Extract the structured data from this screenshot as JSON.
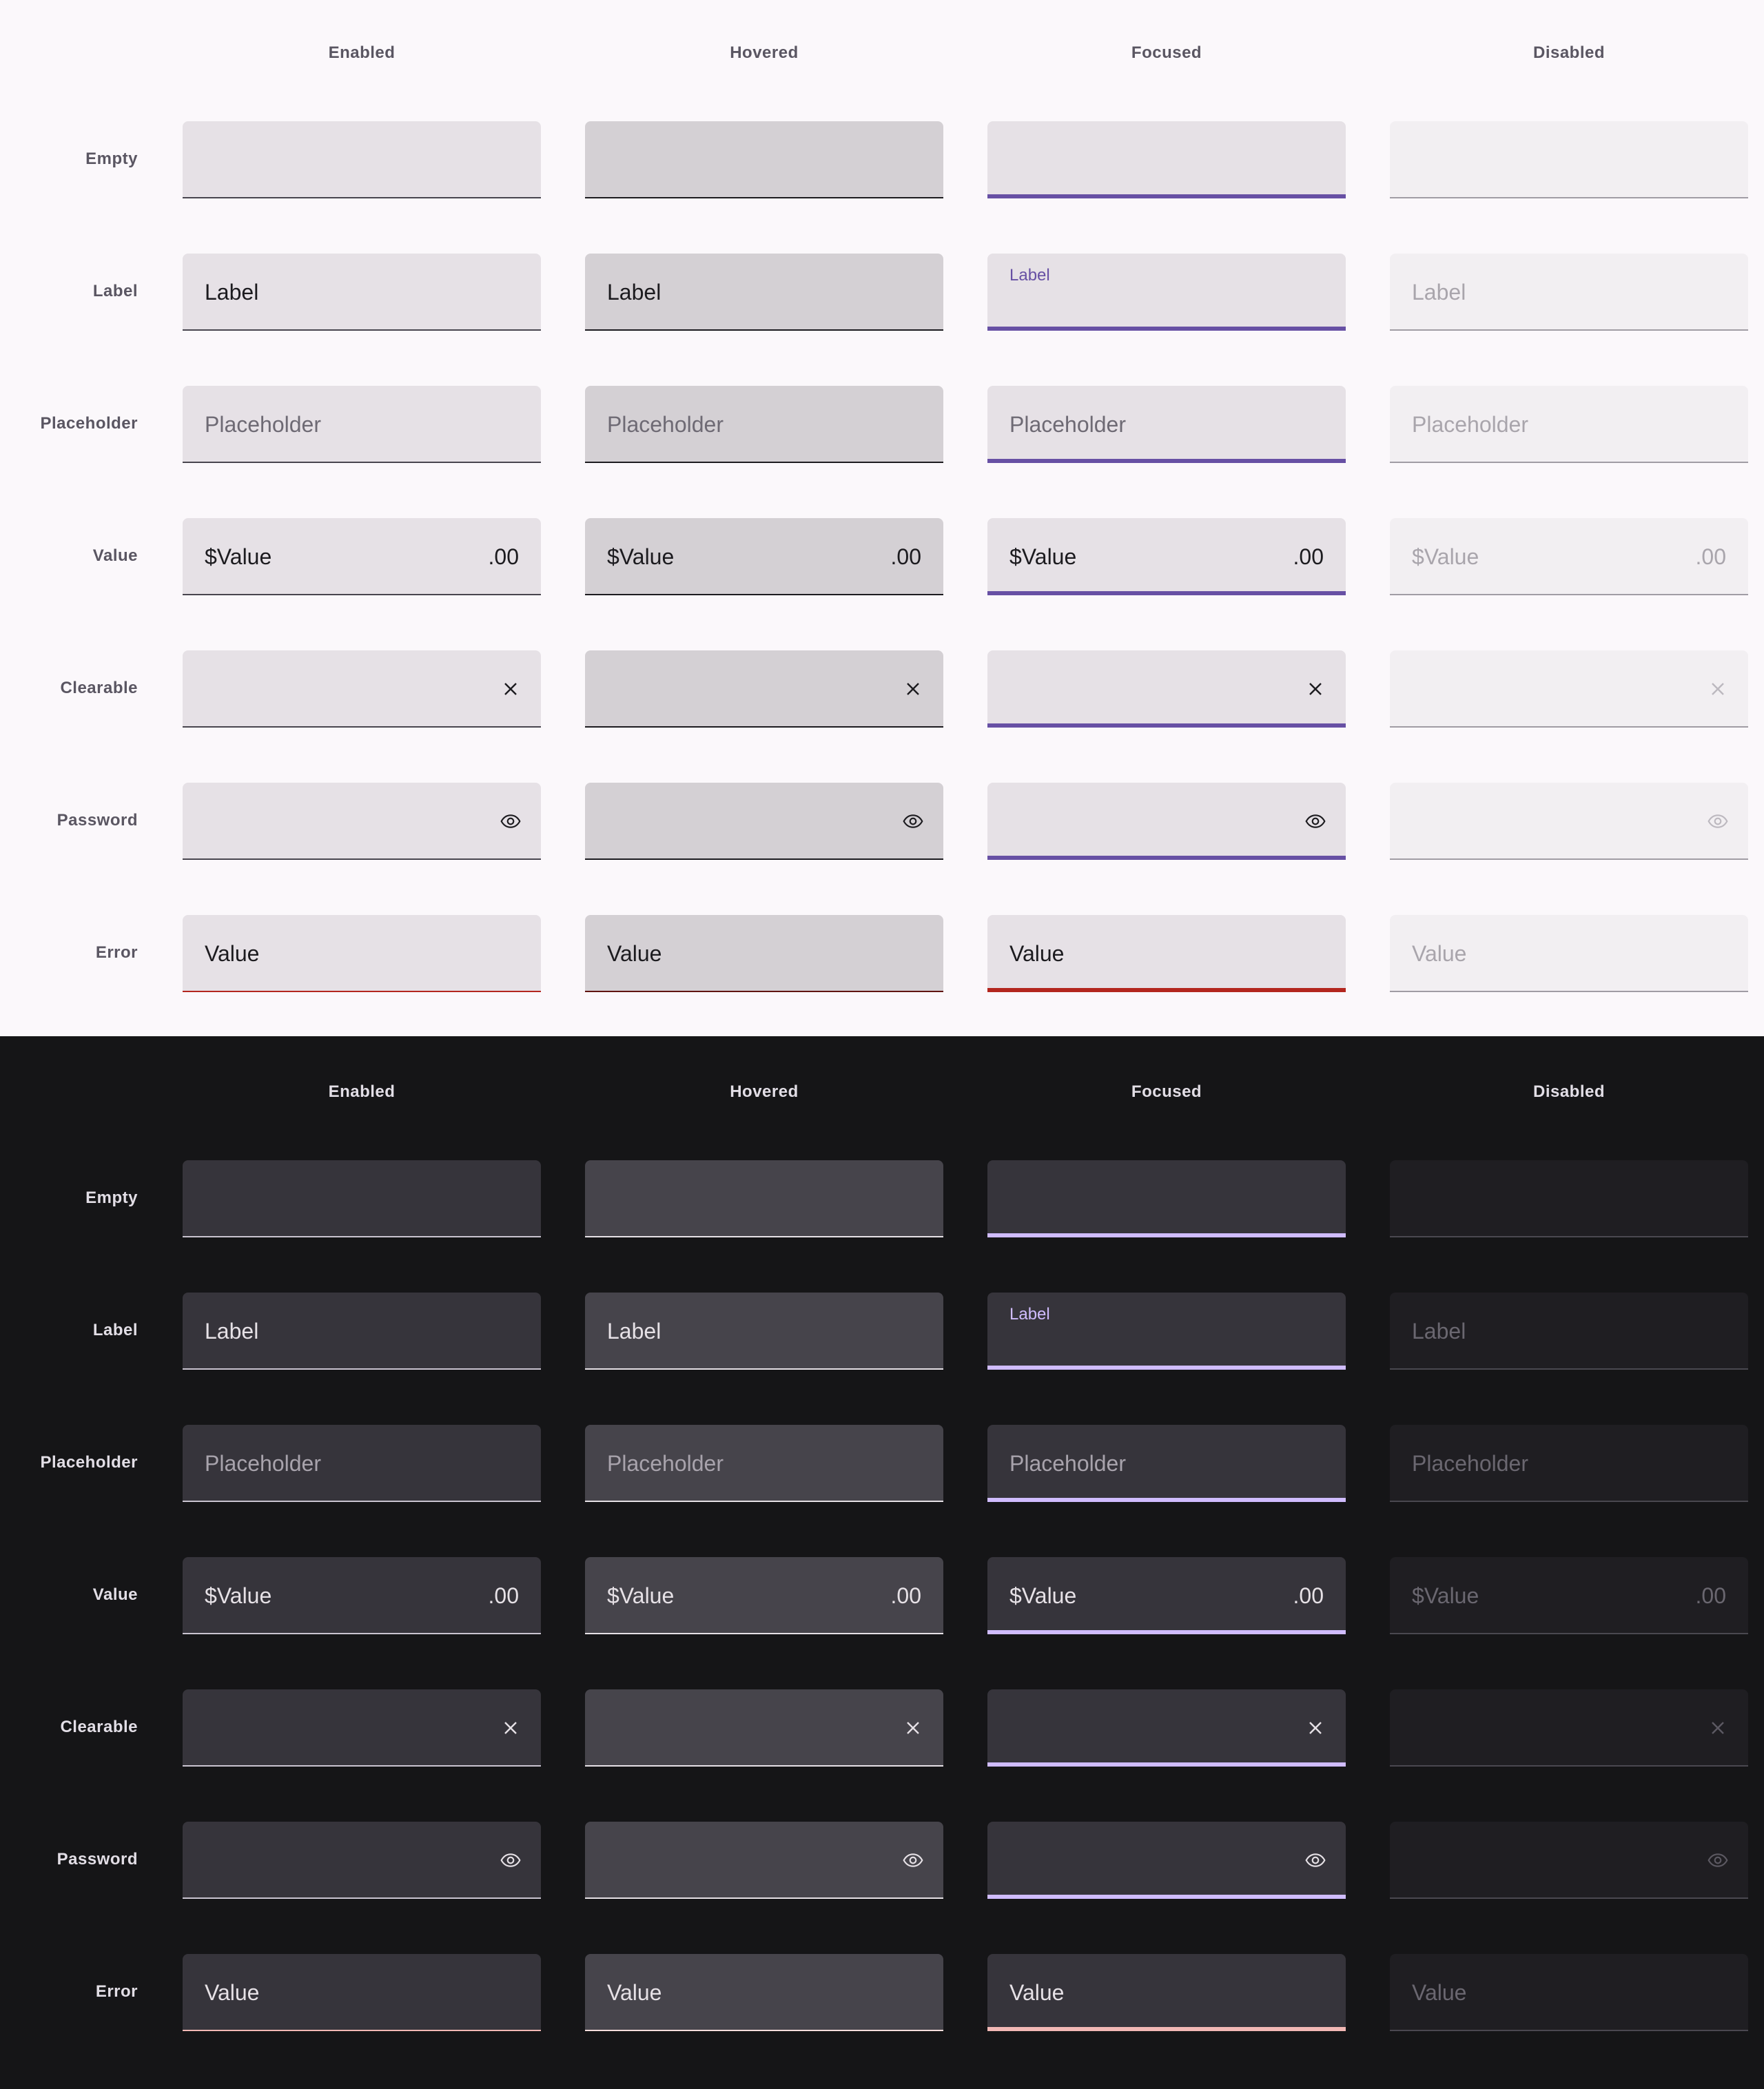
{
  "columns": [
    "Enabled",
    "Hovered",
    "Focused",
    "Disabled"
  ],
  "rows": [
    "Empty",
    "Label",
    "Placeholder",
    "Value",
    "Clearable",
    "Password",
    "Error"
  ],
  "field": {
    "label": "Label",
    "placeholder": "Placeholder",
    "prefix": "$",
    "value": "Value",
    "suffix": ".00",
    "error_value": "Value"
  },
  "icons": {
    "clear": "close-icon",
    "password": "eye-icon"
  },
  "themes": [
    {
      "name": "light",
      "accent": "#6750a4",
      "error": "#b3261e"
    },
    {
      "name": "dark",
      "accent": "#d0bcff",
      "error": "#f2b8b5"
    }
  ]
}
